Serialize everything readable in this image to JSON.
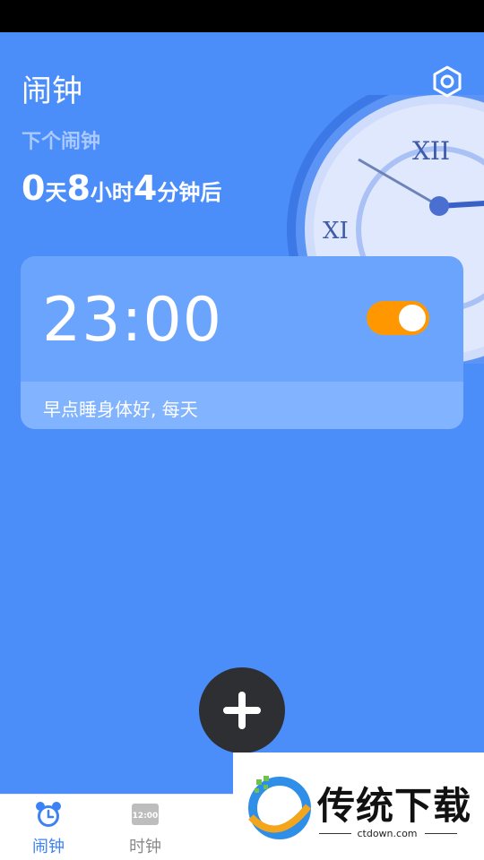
{
  "app": {
    "title": "闹钟"
  },
  "header": {
    "settings_icon": "gear-icon"
  },
  "next_alarm": {
    "label": "下个闹钟",
    "days": "0",
    "days_unit": "天",
    "hours": "8",
    "hours_unit": "小时",
    "minutes": "4",
    "minutes_unit": "分钟后"
  },
  "alarms": [
    {
      "time": "23:00",
      "enabled": true,
      "note": "早点睡身体好, 每天"
    }
  ],
  "fab": {
    "icon": "plus-icon"
  },
  "nav": {
    "items": [
      {
        "label": "闹钟",
        "icon": "alarm-clock-icon",
        "active": true
      },
      {
        "label": "时钟",
        "icon": "digital-clock-icon",
        "icon_text": "12:00",
        "active": false
      }
    ]
  },
  "watermark": {
    "title": "传统下载",
    "url": "ctdown.com"
  },
  "colors": {
    "background": "#4c8ef9",
    "toggle_on": "#ff9800",
    "nav_active": "#3b82f6"
  }
}
